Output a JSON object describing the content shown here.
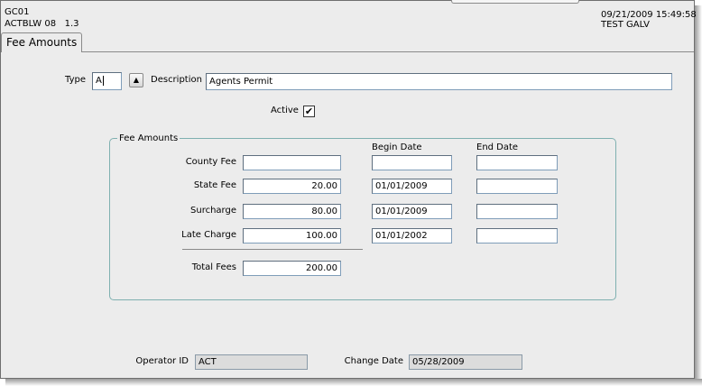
{
  "header": {
    "form_code": "GC01",
    "module": "ACTBLW",
    "module_num": "08",
    "version": "1.3",
    "datetime": "09/21/2009 15:49:58",
    "environment": "TEST GALV"
  },
  "tab": {
    "label": "Fee Amounts"
  },
  "form": {
    "type_label": "Type",
    "type_value": "A",
    "lov_button": "▲",
    "description_label": "Description",
    "description_value": "Agents Permit",
    "active_label": "Active",
    "active_checked": true,
    "active_mark": "✔"
  },
  "fee_group": {
    "title": "Fee Amounts",
    "begin_header": "Begin Date",
    "end_header": "End Date",
    "rows": [
      {
        "label": "County Fee",
        "amount": "",
        "begin": "",
        "end": ""
      },
      {
        "label": "State Fee",
        "amount": "20.00",
        "begin": "01/01/2009",
        "end": ""
      },
      {
        "label": "Surcharge",
        "amount": "80.00",
        "begin": "01/01/2009",
        "end": ""
      },
      {
        "label": "Late Charge",
        "amount": "100.00",
        "begin": "01/01/2002",
        "end": ""
      }
    ],
    "total_label": "Total Fees",
    "total_value": "200.00"
  },
  "footer": {
    "operator_label": "Operator ID",
    "operator_value": "ACT",
    "change_date_label": "Change Date",
    "change_date_value": "05/28/2009"
  }
}
